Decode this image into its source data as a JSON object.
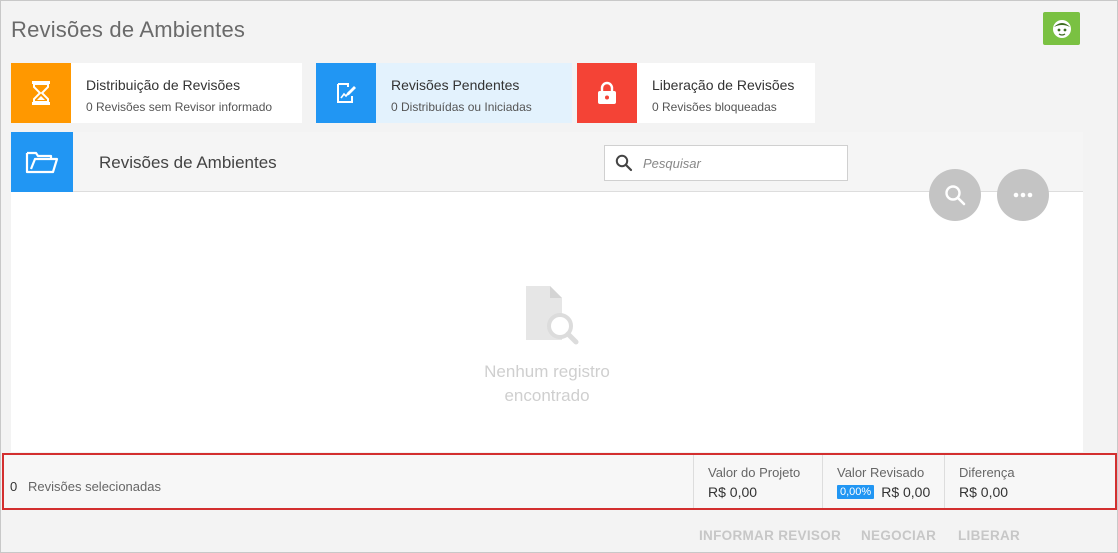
{
  "page": {
    "title": "Revisões de Ambientes"
  },
  "avatar": {
    "icon": "user-face-icon",
    "color": "#7ac142"
  },
  "cards": [
    {
      "title": "Distribuição de Revisões",
      "subtitle": "0 Revisões sem Revisor informado",
      "icon": "hourglass-icon",
      "color": "#ff9800"
    },
    {
      "title": "Revisões Pendentes",
      "subtitle": "0 Distribuídas ou Iniciadas",
      "icon": "edit-chart-icon",
      "color": "#2196f3"
    },
    {
      "title": "Liberação de Revisões",
      "subtitle": "0 Revisões bloqueadas",
      "icon": "lock-icon",
      "color": "#f44336"
    }
  ],
  "panel": {
    "title": "Revisões de Ambientes",
    "icon": "folder-open-icon",
    "search": {
      "placeholder": "Pesquisar",
      "value": ""
    },
    "empty": {
      "line1": "Nenhum registro",
      "line2": "encontrado",
      "icon": "document-search-icon"
    }
  },
  "footer": {
    "selected_count": "0",
    "selected_label": "Revisões selecionadas",
    "valor_projeto": {
      "label": "Valor do Projeto",
      "value": "R$ 0,00"
    },
    "valor_revisado": {
      "label": "Valor Revisado",
      "badge": "0,00%",
      "value": "R$ 0,00"
    },
    "diferenca": {
      "label": "Diferença",
      "value": "R$ 0,00"
    }
  },
  "actions": {
    "informar_revisor": "INFORMAR REVISOR",
    "negociar": "NEGOCIAR",
    "liberar": "LIBERAR"
  }
}
